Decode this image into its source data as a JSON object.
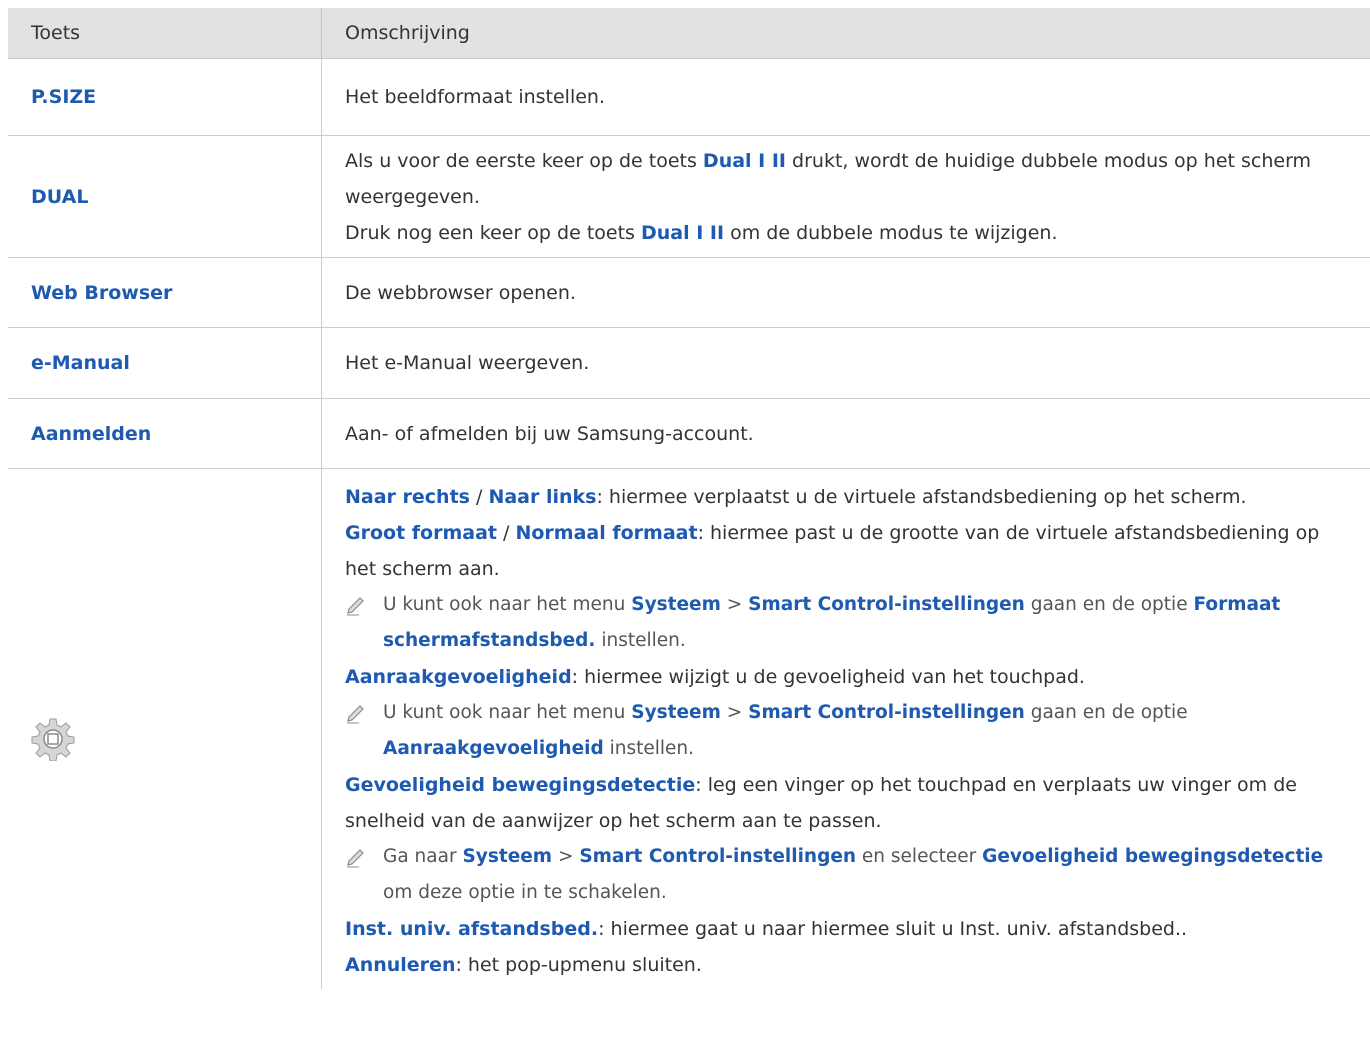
{
  "header": {
    "col1": "Toets",
    "col2": "Omschrijving"
  },
  "rows": [
    {
      "key": "P.SIZE",
      "desc": "Het beeldformaat instellen."
    },
    {
      "key": "DUAL",
      "desc_a": "Als u voor de eerste keer op de toets ",
      "desc_b": "Dual I II",
      "desc_c": " drukt, wordt de huidige dubbele modus op het scherm weergegeven.",
      "desc_d": "Druk nog een keer op de toets ",
      "desc_e": "Dual I II",
      "desc_f": " om de dubbele modus te wijzigen."
    },
    {
      "key": "Web Browser",
      "desc": "De webbrowser openen."
    },
    {
      "key": "e-Manual",
      "desc": "Het e-Manual weergeven."
    },
    {
      "key": "Aanmelden",
      "desc": "Aan- of afmelden bij uw Samsung-account."
    }
  ],
  "settings": {
    "l1a": "Naar rechts",
    "l1b": " / ",
    "l1c": "Naar links",
    "l1d": ": hiermee verplaatst u de virtuele afstandsbediening op het scherm.",
    "l2a": "Groot formaat",
    "l2b": " / ",
    "l2c": "Normaal formaat",
    "l2d": ": hiermee past u de grootte van de virtuele afstandsbediening op het scherm aan.",
    "n1a": "U kunt ook naar het menu ",
    "n1b": "Systeem",
    "n1c": " > ",
    "n1d": "Smart Control-instellingen",
    "n1e": " gaan en de optie ",
    "n1f": "Formaat schermafstandsbed.",
    "n1g": " instellen.",
    "l3a": "Aanraakgevoeligheid",
    "l3b": ": hiermee wijzigt u de gevoeligheid van het touchpad.",
    "n2a": "U kunt ook naar het menu ",
    "n2b": "Systeem",
    "n2c": " > ",
    "n2d": "Smart Control-instellingen",
    "n2e": " gaan en de optie ",
    "n2f": "Aanraakgevoeligheid",
    "n2g": " instellen.",
    "l4a": "Gevoeligheid bewegingsdetectie",
    "l4b": ": leg een vinger op het touchpad en verplaats uw vinger om de snelheid van de aanwijzer op het scherm aan te passen.",
    "n3a": "Ga naar ",
    "n3b": "Systeem",
    "n3c": " > ",
    "n3d": "Smart Control-instellingen",
    "n3e": " en selecteer ",
    "n3f": "Gevoeligheid bewegingsdetectie",
    "n3g": " om deze optie in te schakelen.",
    "l5a": "Inst. univ. afstandsbed.",
    "l5b": ": hiermee gaat u naar hiermee sluit u Inst. univ. afstandsbed..",
    "l6a": "Annuleren",
    "l6b": ": het pop-upmenu sluiten."
  },
  "icons": {
    "settings_key": "gear-icon",
    "note": "pencil-icon"
  },
  "colors": {
    "header_bg": "#e2e2e2",
    "key_blue": "#1e5ab0",
    "border": "#cccccc"
  }
}
